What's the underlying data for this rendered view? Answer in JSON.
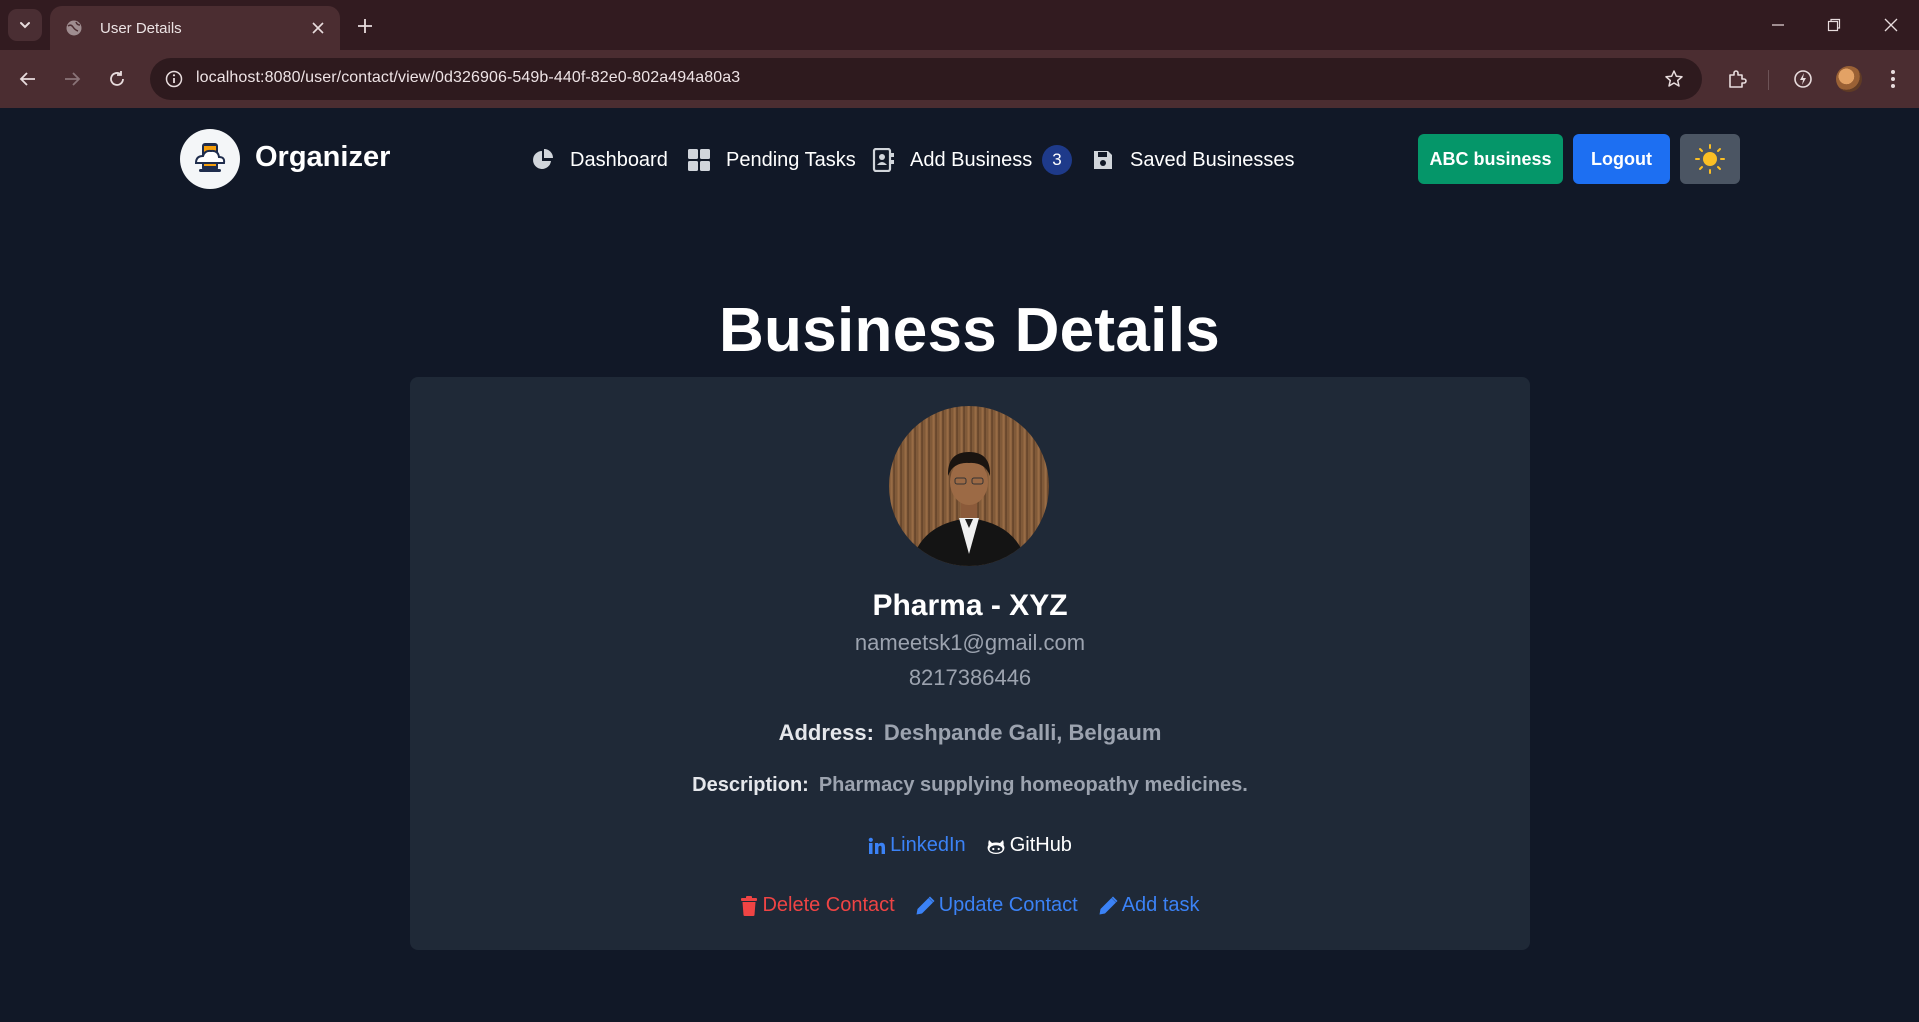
{
  "browser": {
    "tab_title": "User Details",
    "url": "localhost:8080/user/contact/view/0d326906-549b-440f-82e0-802a494a80a3"
  },
  "navbar": {
    "brand": "Organizer",
    "items": [
      {
        "label": "Dashboard",
        "icon": "pie-chart-icon"
      },
      {
        "label": "Pending Tasks",
        "icon": "grid-icon"
      },
      {
        "label": "Add Business",
        "icon": "address-book-icon"
      },
      {
        "label": "Saved Businesses",
        "icon": "floppy-disk-icon"
      }
    ],
    "badge_count": "3",
    "business_button": "ABC business",
    "logout_button": "Logout",
    "theme_icon": "sun-icon"
  },
  "page": {
    "title": "Business Details"
  },
  "contact": {
    "name": "Pharma - XYZ",
    "email": "nameetsk1@gmail.com",
    "phone": "8217386446",
    "address_label": "Address:",
    "address": "Deshpande Galli, Belgaum",
    "description_label": "Description:",
    "description": "Pharmacy supplying homeopathy medicines.",
    "links": {
      "linkedin": "LinkedIn",
      "github": "GitHub"
    },
    "actions": {
      "delete": "Delete Contact",
      "update": "Update Contact",
      "add_task": "Add task"
    }
  },
  "colors": {
    "page_bg": "#111827",
    "card_bg": "#1f2937",
    "business_btn": "#059669",
    "logout_btn": "#1d6ff2",
    "delete": "#ef4444",
    "link": "#3b82f6"
  }
}
